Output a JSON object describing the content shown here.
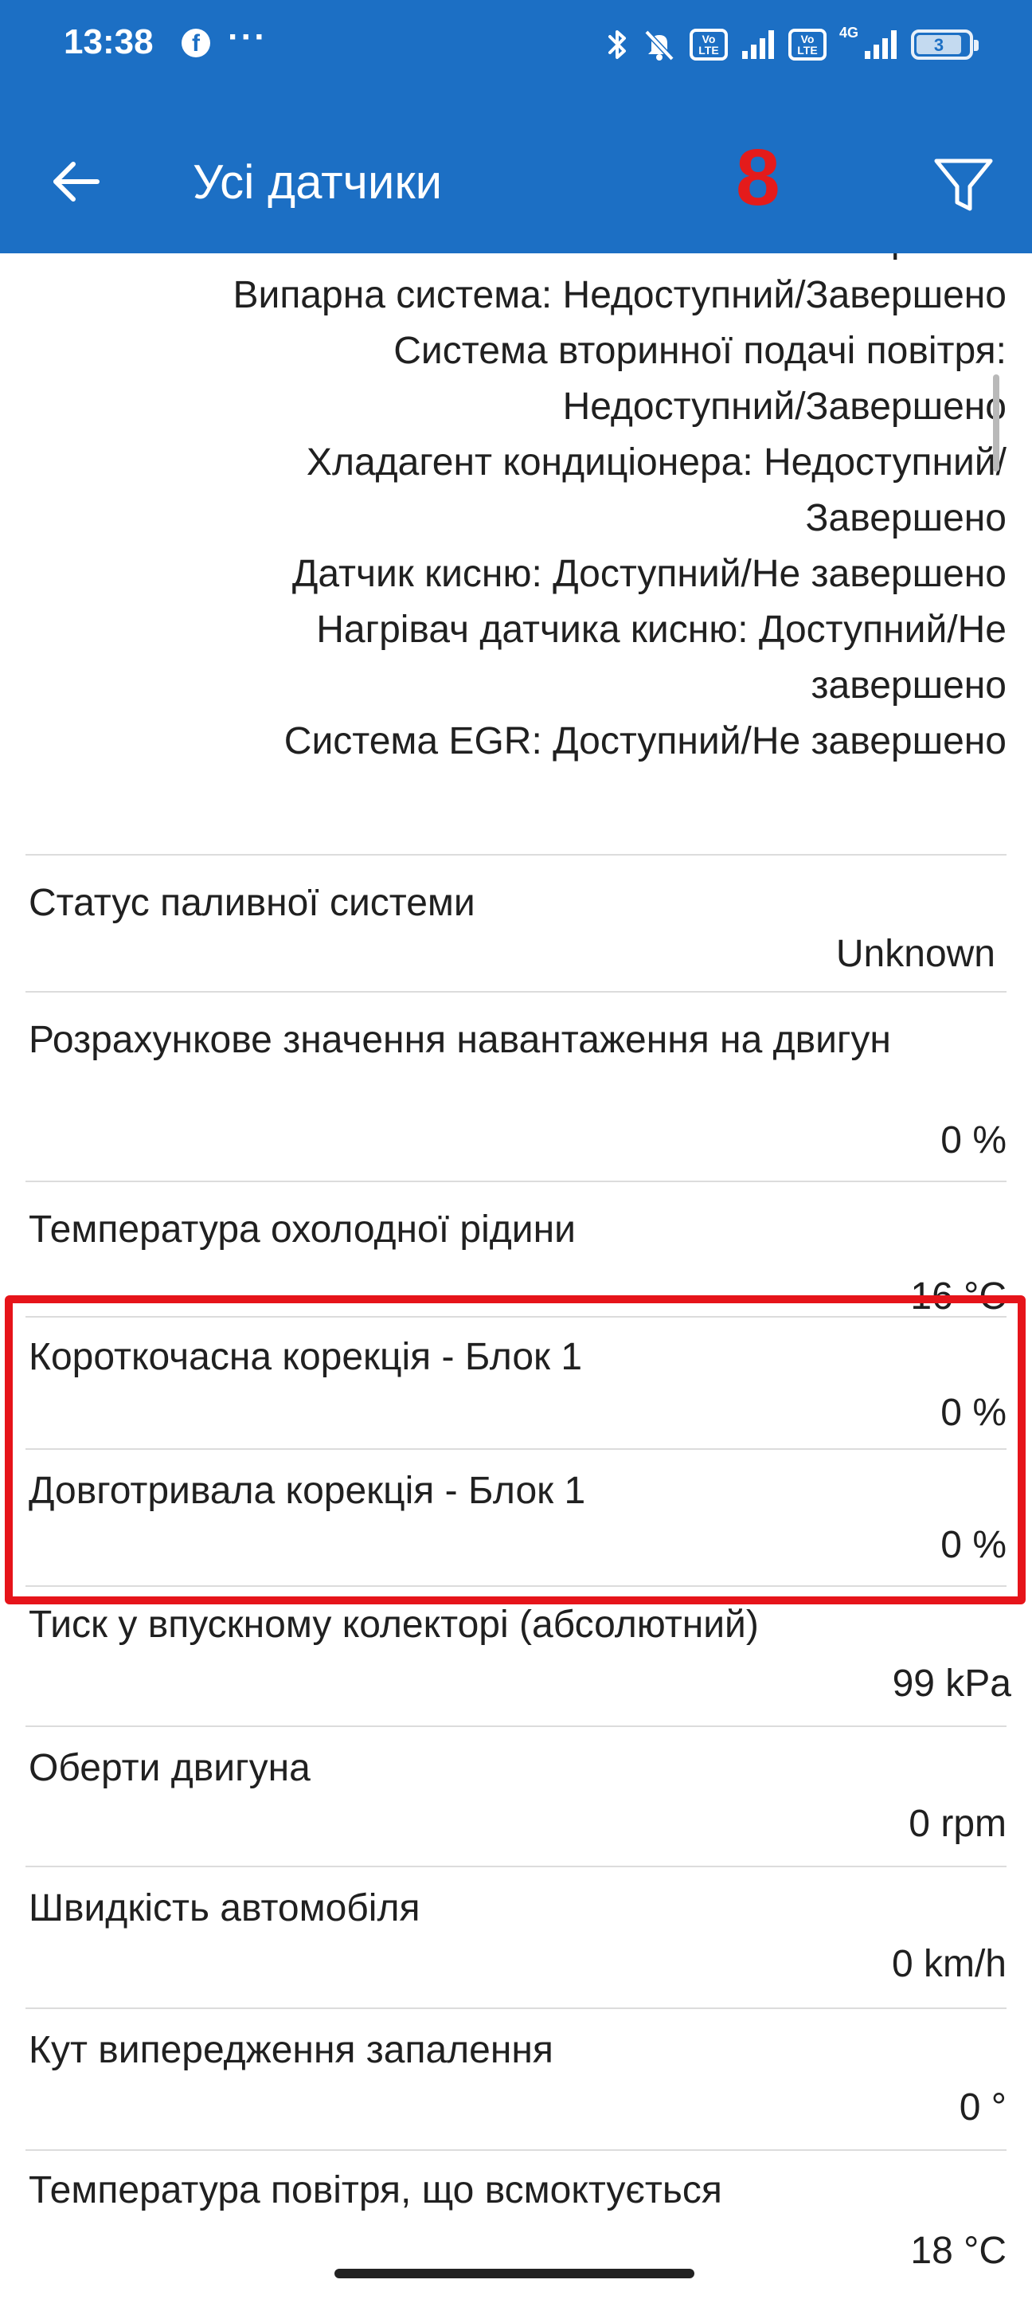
{
  "status_bar": {
    "time": "13:38",
    "more": "···",
    "volte_label": "Vo LTE",
    "network": "4G",
    "battery": "3"
  },
  "app_bar": {
    "title": "Усі датчики",
    "page_number": "8"
  },
  "readiness_lines": [
    "Завершено",
    "Випарна система: Недоступний/Завершено",
    "Система вторинної подачі повітря:",
    "Недоступний/Завершено",
    "Хладагент кондиціонера: Недоступний/",
    "Завершено",
    "Датчик кисню: Доступний/Не завершено",
    "Нагрівач датчика кисню: Доступний/Не",
    "завершено",
    "Система EGR: Доступний/Не завершено"
  ],
  "sensors": [
    {
      "label": "Статус паливної системи",
      "value": "Unknown"
    },
    {
      "label": "Розрахункове значення навантаження на двигун",
      "value": "0 %"
    },
    {
      "label": "Температура охолодної рідини",
      "value": "16 °C"
    },
    {
      "label": "Короткочасна корекція - Блок 1",
      "value": "0 %"
    },
    {
      "label": "Довготривала корекція - Блок 1",
      "value": "0 %"
    },
    {
      "label": "Тиск у впускному колекторі (абсолютний)",
      "value": "99 kPa"
    },
    {
      "label": "Оберти двигуна",
      "value": "0 rpm"
    },
    {
      "label": "Швидкість автомобіля",
      "value": "0 km/h"
    },
    {
      "label": "Кут випередження запалення",
      "value": "0 °"
    },
    {
      "label": "Температура повітря, що всмоктується",
      "value": "18 °C"
    }
  ],
  "colors": {
    "app_bar": "#1c6fc4",
    "page_number": "#e41b1b",
    "highlight": "#e6141a"
  }
}
